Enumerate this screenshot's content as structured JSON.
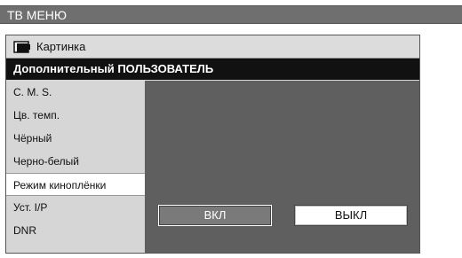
{
  "window": {
    "title": "ТВ МЕНЮ"
  },
  "breadcrumb": {
    "label": "Картинка",
    "icon": "picture-icon"
  },
  "section": {
    "title": "Дополнительный ПОЛЬЗОВАТЕЛЬ"
  },
  "menu": {
    "items": [
      {
        "label": "C. M. S."
      },
      {
        "label": "Цв. темп."
      },
      {
        "label": "Чёрный"
      },
      {
        "label": "Черно-белый"
      },
      {
        "label": "Режим киноплёнки",
        "selected": true
      },
      {
        "label": "Уст. I/P"
      },
      {
        "label": "DNR"
      }
    ]
  },
  "options": {
    "on_label": "ВКЛ",
    "off_label": "ВЫКЛ",
    "selected": "ВЫКЛ"
  },
  "colors": {
    "titlebar": "#6f6f6f",
    "header": "#111111",
    "content_bg": "#5f5f5f",
    "menu_bg": "#d6d6d6"
  }
}
